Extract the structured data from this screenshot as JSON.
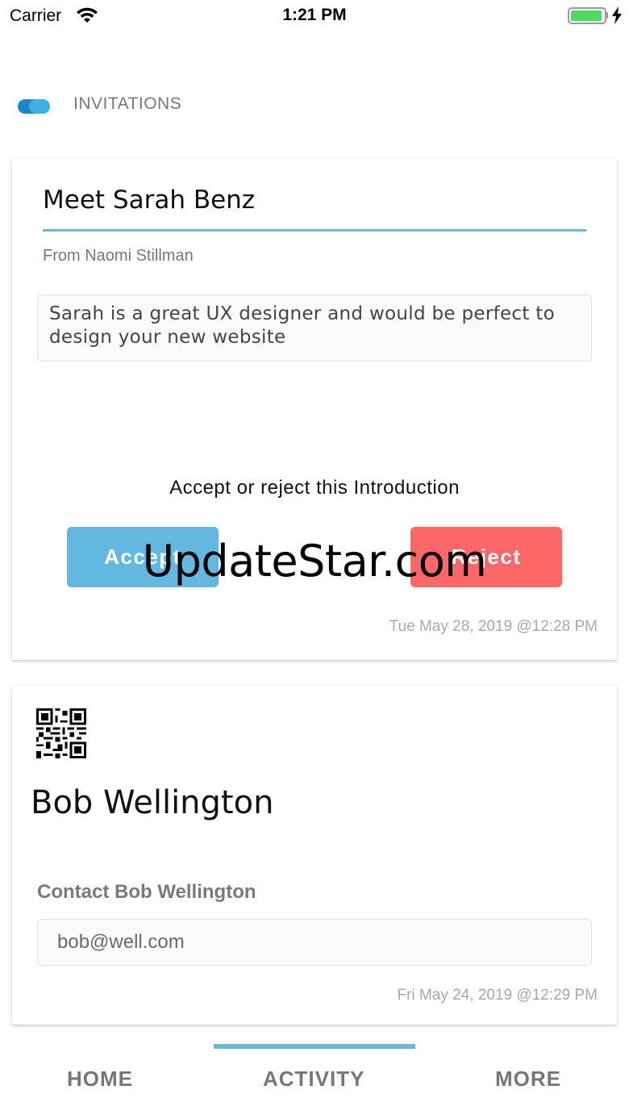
{
  "status_bar": {
    "carrier": "Carrier",
    "time": "1:21 PM",
    "battery_level": 0.95,
    "icons": [
      "wifi-icon",
      "battery-icon",
      "charging-bolt-icon"
    ]
  },
  "header": {
    "title": "INVITATIONS",
    "logo_icon": "app-logo-icon"
  },
  "introduction": {
    "title": "Meet Sarah Benz",
    "from": "From Naomi Stillman",
    "message": "Sarah is a great UX designer and would be perfect to design your new website",
    "prompt": "Accept or reject this Introduction",
    "accept_label": "Accept",
    "reject_label": "Reject",
    "timestamp": "Tue May 28, 2019 @12:28 PM"
  },
  "contact": {
    "qr_icon": "qr-code-icon",
    "name": "Bob Wellington",
    "heading": "Contact Bob Wellington",
    "email": "bob@well.com",
    "timestamp": "Fri May 24, 2019 @12:29 PM"
  },
  "watermark": "UpdateStar.com",
  "nav": {
    "home": "HOME",
    "activity": "ACTIVITY",
    "more": "MORE",
    "active": "ACTIVITY"
  },
  "colors": {
    "accent": "#6db7d6",
    "accept": "#62b8e0",
    "reject": "#fe6767",
    "battery": "#4cd964"
  }
}
